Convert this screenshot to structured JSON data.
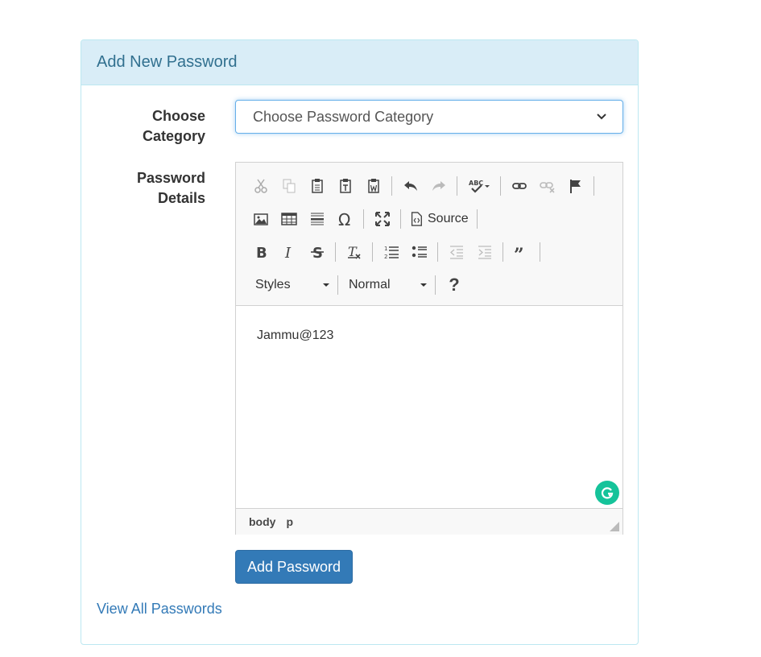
{
  "panel": {
    "title": "Add New Password"
  },
  "form": {
    "category_label_line1": "Choose",
    "category_label_line2": "Category",
    "category_selected": "Choose Password Category",
    "details_label_line1": "Password",
    "details_label_line2": "Details"
  },
  "editor": {
    "source_label": "Source",
    "styles_combo": "Styles",
    "format_combo": "Normal",
    "help_label": "?",
    "content_text": "Jammu@123",
    "path": [
      "body",
      "p"
    ],
    "toolbar_icons": [
      [
        "cut-icon",
        "copy-icon",
        "paste-icon",
        "paste-text-icon",
        "paste-word-icon",
        "undo-icon",
        "redo-icon",
        "spellcheck-icon",
        "link-icon",
        "unlink-icon",
        "anchor-icon"
      ],
      [
        "image-icon",
        "table-icon",
        "horizontal-rule-icon",
        "special-char-icon",
        "maximize-icon",
        "source-icon"
      ],
      [
        "bold-icon",
        "italic-icon",
        "strike-icon",
        "remove-format-icon",
        "numbered-list-icon",
        "bulleted-list-icon",
        "outdent-icon",
        "indent-icon",
        "blockquote-icon"
      ]
    ]
  },
  "actions": {
    "submit_label": "Add Password",
    "view_all_label": "View All Passwords"
  },
  "colors": {
    "panel_heading_bg": "#d9edf7",
    "panel_title": "#31708f",
    "primary": "#337ab7",
    "grammarly": "#15c39a"
  }
}
